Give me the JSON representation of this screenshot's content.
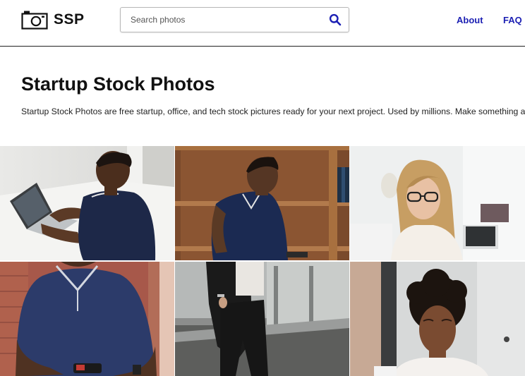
{
  "header": {
    "logo_text": "SSP",
    "logo_icon": "camera-icon",
    "search": {
      "placeholder": "Search photos",
      "value": "",
      "icon": "search-icon"
    },
    "nav": [
      {
        "label": "About"
      },
      {
        "label": "FAQ"
      }
    ]
  },
  "hero": {
    "title": "Startup Stock Photos",
    "subtitle": "Startup Stock Photos are free startup, office, and tech stock pictures ready for your next project. Used by millions. Make something awesome."
  },
  "colors": {
    "nav_link": "#1b1fb3",
    "search_icon": "#1b1fb3",
    "text": "#111111",
    "header_border": "#222222"
  }
}
